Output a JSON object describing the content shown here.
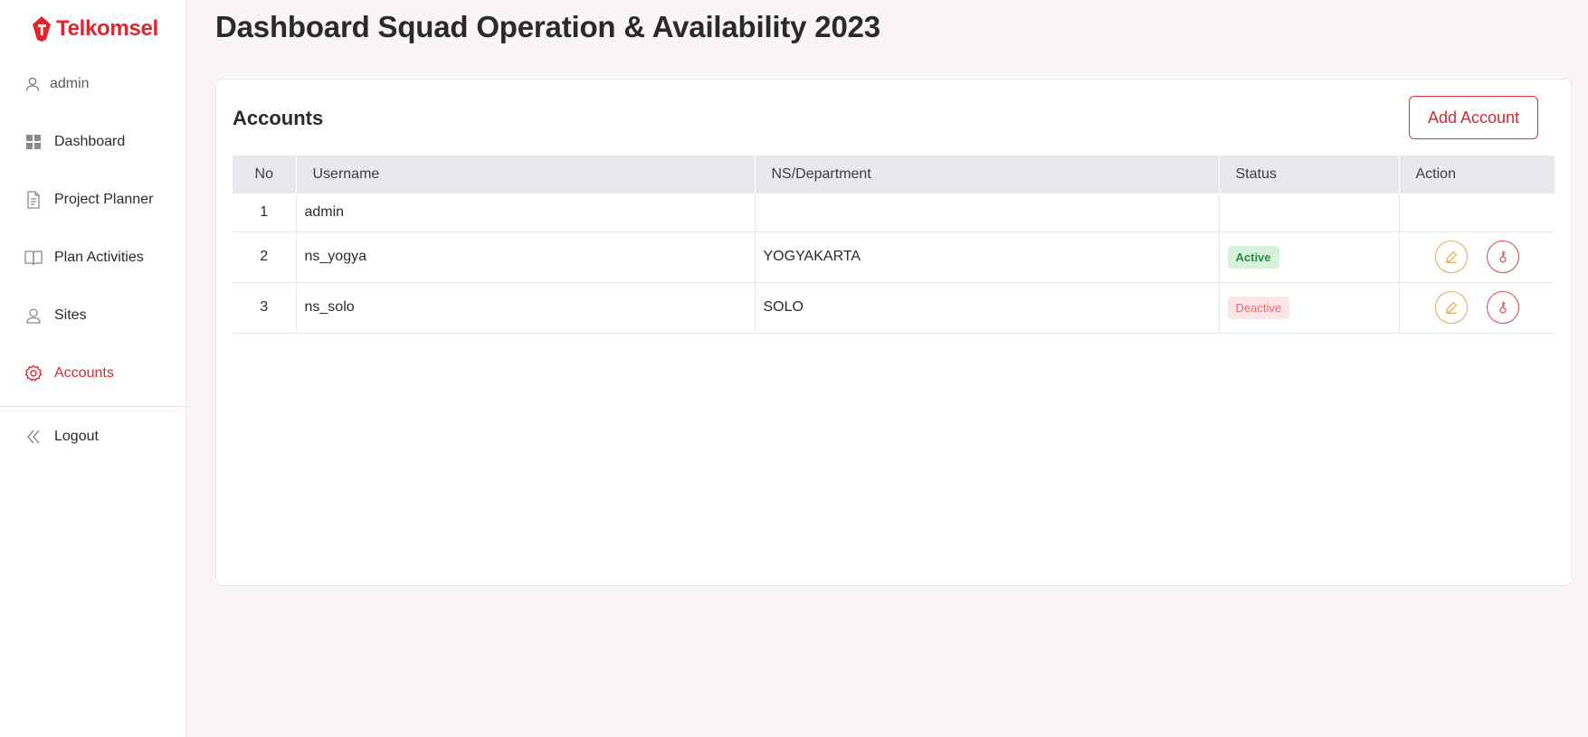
{
  "brand": {
    "name": "Telkomsel",
    "color": "#e0262d"
  },
  "user": {
    "name": "admin",
    "icon": "user-icon"
  },
  "nav": [
    {
      "label": "Dashboard",
      "icon": "grid-icon",
      "active": false
    },
    {
      "label": "Project Planner",
      "icon": "document-icon",
      "active": false
    },
    {
      "label": "Plan Activities",
      "icon": "book-icon",
      "active": false
    },
    {
      "label": "Sites",
      "icon": "location-icon",
      "active": false
    },
    {
      "label": "Accounts",
      "icon": "gear-icon",
      "active": true
    }
  ],
  "logout": {
    "label": "Logout",
    "icon": "double-chevron-left-icon"
  },
  "page": {
    "title": "Dashboard Squad Operation & Availability 2023"
  },
  "accounts": {
    "title": "Accounts",
    "add_label": "Add Account",
    "columns": [
      "No",
      "Username",
      "NS/Department",
      "Status",
      "Action"
    ],
    "rows": [
      {
        "no": "1",
        "username": "admin",
        "department": "",
        "status": ""
      },
      {
        "no": "2",
        "username": "ns_yogya",
        "department": "YOGYAKARTA",
        "status": "Active"
      },
      {
        "no": "3",
        "username": "ns_solo",
        "department": "SOLO",
        "status": "Deactive"
      }
    ]
  },
  "colors": {
    "accent": "#d92a2f",
    "active_badge": "#2e8a45",
    "deactive_badge": "#e06a6f",
    "edit": "#e8a753"
  }
}
